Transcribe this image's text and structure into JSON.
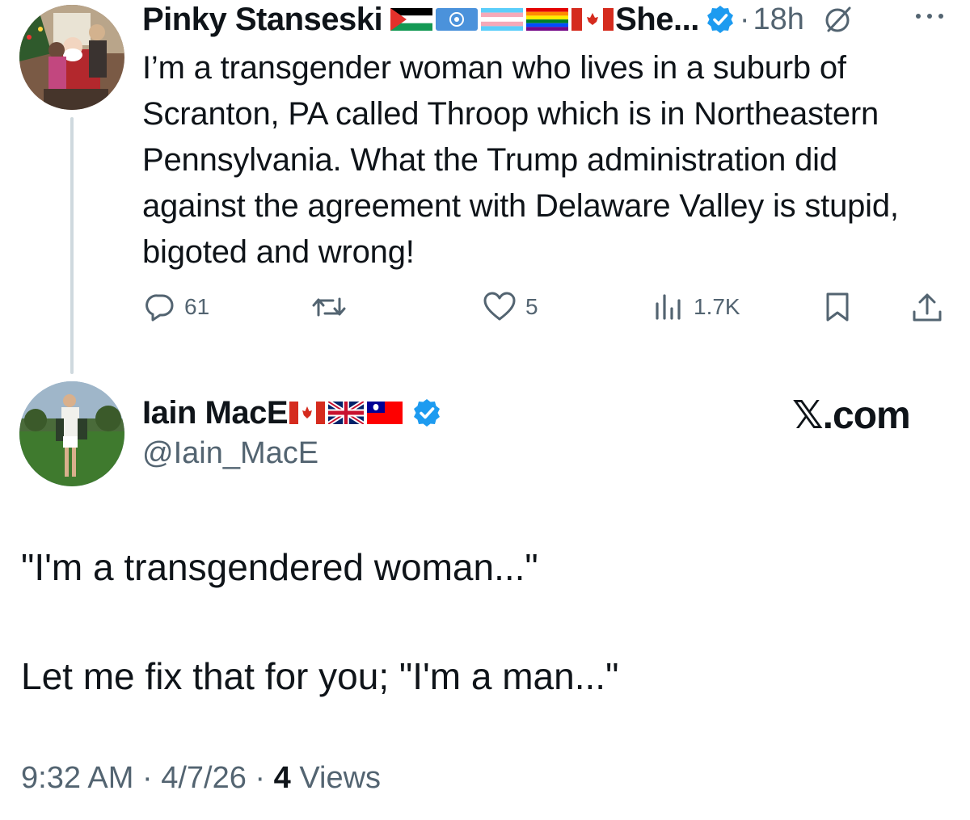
{
  "post1": {
    "author_name": "Pinky Stanseski",
    "name_suffix": "She...",
    "dot": "·",
    "time": "18h",
    "body": "I’m a transgender woman who lives in a suburb of Scranton, PA called Throop which is in Northeastern Pennsylvania. What the Trump administration did against the agreement with Delaware Valley is stupid, bigoted and wrong!",
    "flag_icons": [
      "palestine-flag",
      "un-flag",
      "transgender-flag",
      "rainbow-flag",
      "canada-flag"
    ],
    "actions": {
      "replies": "61",
      "reposts": "",
      "likes": "5",
      "views": "1.7K"
    }
  },
  "post2": {
    "author_name": "Iain MacE",
    "handle": "@Iain_MacE",
    "flag_icons": [
      "canada-flag",
      "uk-flag",
      "taiwan-flag"
    ],
    "line1": "\"I'm a transgendered woman...\"",
    "line2": "Let me fix that for you; \"I'm a man...\"",
    "time": "9:32 AM",
    "date": "4/7/26",
    "sep": "·",
    "views_count": "4",
    "views_label": "Views"
  },
  "brand": "𝕏.com",
  "colors": {
    "text": "#0f1419",
    "secondary": "#536471",
    "verified": "#1d9bf0",
    "thread_line": "#cfd9de"
  }
}
